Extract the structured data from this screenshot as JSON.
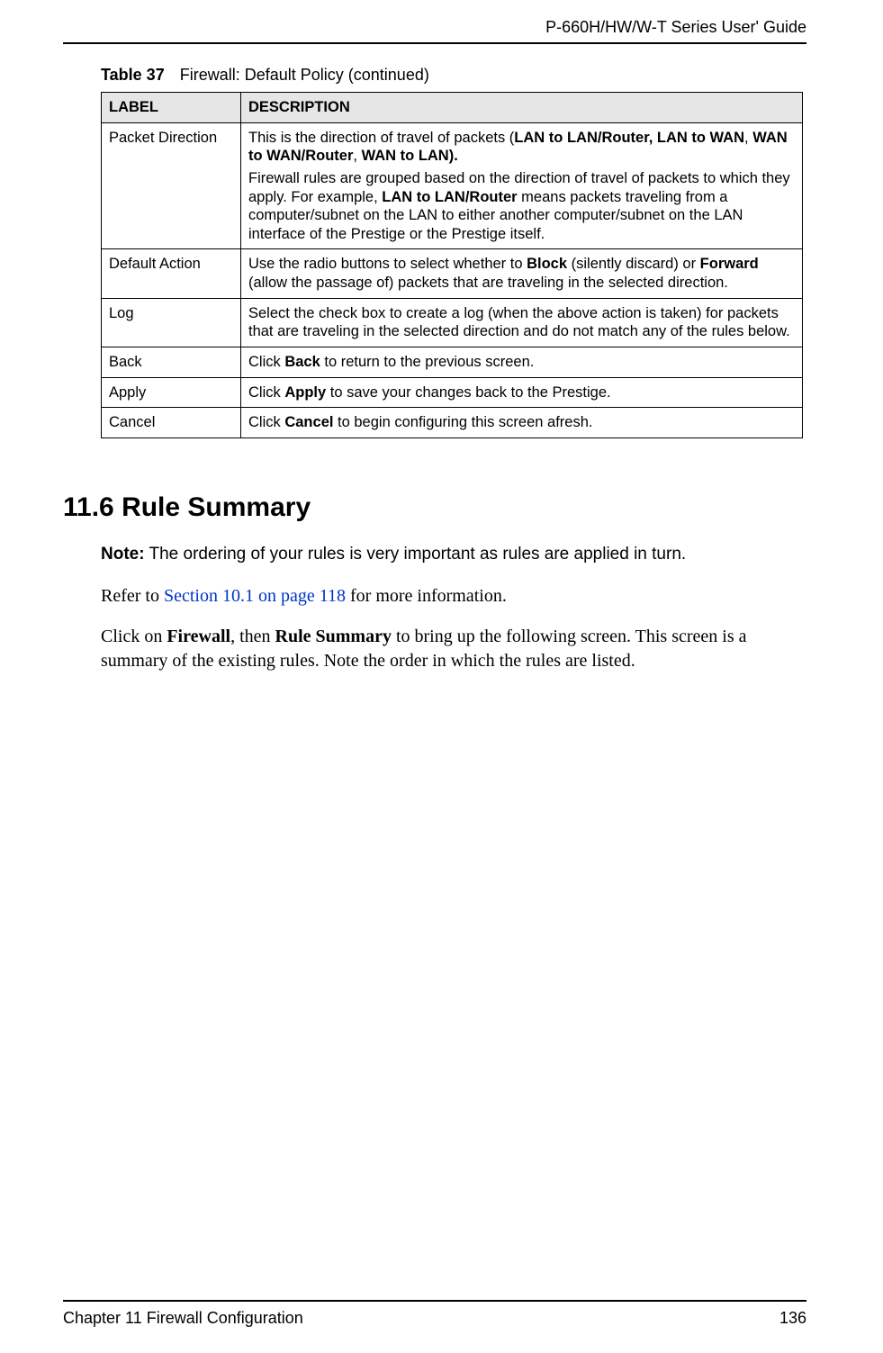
{
  "header": {
    "guide_title": "P-660H/HW/W-T Series User' Guide"
  },
  "table_caption": {
    "label": "Table 37",
    "text": "Firewall: Default Policy (continued)"
  },
  "table": {
    "headers": {
      "label": "LABEL",
      "description": "DESCRIPTION"
    },
    "rows": [
      {
        "label": "Packet Direction",
        "desc1_pre": "This is the direction of travel of packets (",
        "desc1_bold1": "LAN to LAN/Router, LAN to WAN",
        "desc1_mid1": ", ",
        "desc1_bold2": "WAN to WAN/Router",
        "desc1_mid2": ", ",
        "desc1_bold3": "WAN to LAN).",
        "desc2_pre": "Firewall rules are grouped based on the direction of travel of packets to which they apply. For example, ",
        "desc2_bold": "LAN to LAN/Router",
        "desc2_post": " means packets traveling from a computer/subnet on the LAN to either another computer/subnet on the LAN interface of the Prestige or the Prestige itself."
      },
      {
        "label": "Default Action",
        "desc_pre": "Use the radio buttons to select whether to ",
        "desc_bold1": "Block",
        "desc_mid1": " (silently discard) or ",
        "desc_bold2": "Forward",
        "desc_post": " (allow the passage of) packets that are traveling in the selected direction."
      },
      {
        "label": "Log",
        "desc": "Select the check box to create a log (when the above action is taken) for packets that are traveling in the selected direction and do not match any of the rules below."
      },
      {
        "label": "Back",
        "desc_pre": "Click ",
        "desc_bold": "Back",
        "desc_post": " to return to the previous screen."
      },
      {
        "label": "Apply",
        "desc_pre": "Click ",
        "desc_bold": "Apply",
        "desc_post": " to save your changes back to the Prestige."
      },
      {
        "label": "Cancel",
        "desc_pre": "Click ",
        "desc_bold": "Cancel",
        "desc_post": " to begin configuring this screen afresh."
      }
    ]
  },
  "section": {
    "heading": "11.6  Rule Summary",
    "note_label": "Note:",
    "note_text": " The ordering of your rules is very important as rules are applied in turn.",
    "refer_pre": "Refer to ",
    "refer_link": "Section 10.1 on page 118",
    "refer_post": " for more information.",
    "body_pre": "Click on ",
    "body_bold1": "Firewall",
    "body_mid1": ", then ",
    "body_bold2": "Rule Summary",
    "body_post": " to bring up the following screen. This screen is a summary of the existing rules. Note the order in which the rules are listed."
  },
  "footer": {
    "chapter": "Chapter 11 Firewall Configuration",
    "page": "136"
  }
}
